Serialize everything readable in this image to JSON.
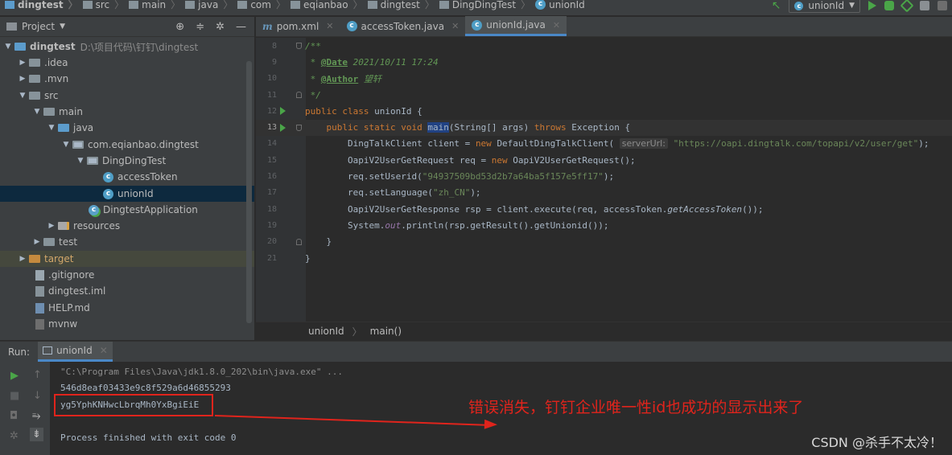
{
  "colors": {
    "accent": "#4a88c7",
    "run_green": "#4aa548",
    "annotation_red": "#e0241c",
    "keyword": "#cc7832",
    "string": "#6a8759",
    "comment": "#629755"
  },
  "breadcrumb": [
    "dingtest",
    "src",
    "main",
    "java",
    "com",
    "eqianbao",
    "dingtest",
    "DingDingTest",
    "unionId"
  ],
  "toolbar": {
    "run_config": "unionId",
    "run_icon": "play-icon",
    "debug_icon": "debug-icon",
    "build_icon": "hammer-icon"
  },
  "project": {
    "title": "Project",
    "tree": [
      {
        "label": "dingtest",
        "path": "D:\\项目代码\\钉钉\\dingtest",
        "icon": "module-folder-icon"
      },
      {
        "label": ".idea",
        "icon": "folder-icon"
      },
      {
        "label": ".mvn",
        "icon": "folder-icon"
      },
      {
        "label": "src",
        "icon": "folder-icon"
      },
      {
        "label": "main",
        "icon": "folder-icon"
      },
      {
        "label": "java",
        "icon": "source-folder-icon"
      },
      {
        "label": "com.eqianbao.dingtest",
        "icon": "package-icon"
      },
      {
        "label": "DingDingTest",
        "icon": "package-icon"
      },
      {
        "label": "accessToken",
        "icon": "class-icon"
      },
      {
        "label": "unionId",
        "icon": "class-icon"
      },
      {
        "label": "DingtestApplication",
        "icon": "spring-class-icon"
      },
      {
        "label": "resources",
        "icon": "resources-folder-icon"
      },
      {
        "label": "test",
        "icon": "folder-icon"
      },
      {
        "label": "target",
        "icon": "excluded-folder-icon"
      },
      {
        "label": ".gitignore",
        "icon": "gitignore-file-icon"
      },
      {
        "label": "dingtest.iml",
        "icon": "iml-file-icon"
      },
      {
        "label": "HELP.md",
        "icon": "markdown-file-icon"
      },
      {
        "label": "mvnw",
        "icon": "script-file-icon"
      }
    ]
  },
  "editor": {
    "tabs": [
      {
        "label": "pom.xml"
      },
      {
        "label": "accessToken.java"
      },
      {
        "label": "unionId.java"
      }
    ],
    "line_numbers": [
      "8",
      "9",
      "10",
      "11",
      "12",
      "13",
      "14",
      "15",
      "16",
      "17",
      "18",
      "19",
      "20",
      "21"
    ],
    "comment": {
      "open": "/**",
      "date_tag": "@Date",
      "date_val": "2021/10/11 17:24",
      "author_tag": "@Author",
      "author_val": "望轩",
      "close": "*/",
      "star": "*"
    },
    "code": {
      "kw_public": "public",
      "kw_class": "class",
      "class_name": "unionId",
      "brace_open": "{",
      "kw_static": "static",
      "kw_void": "void",
      "method": "main",
      "params": "(String[] args)",
      "kw_throws": "throws",
      "exception": "Exception",
      "l14a": "DingTalkClient client = ",
      "kw_new": "new",
      "l14b": "DefaultDingTalkClient(",
      "hint": "serverUrl:",
      "url": "\"https://oapi.dingtalk.com/topapi/v2/user/get\"",
      "l14c": ");",
      "l15a": "OapiV2UserGetRequest req = ",
      "l15b": "OapiV2UserGetRequest();",
      "l16a": "req.setUserid(",
      "userid": "\"94937509bd53d2b7a64ba5f157e5ff17\"",
      "l16b": ");",
      "l17a": "req.setLanguage(",
      "lang": "\"zh_CN\"",
      "l17b": ");",
      "l18a": "OapiV2UserGetResponse rsp = client.execute(req, accessToken.",
      "l18m": "getAccessToken",
      "l18b": "());",
      "l19a": "System.",
      "l19out": "out",
      "l19b": ".println(rsp.getResult().getUnionid());",
      "brace_close": "}"
    },
    "breadcrumb": {
      "cls": "unionId",
      "method": "main()"
    }
  },
  "run": {
    "label": "Run:",
    "tab": "unionId",
    "cmd": "\"C:\\Program Files\\Java\\jdk1.8.0_202\\bin\\java.exe\" ...",
    "out1": "546d8eaf03433e9c8f529a6d46855293",
    "out2": "yg5YphKNHwcLbrqMh0YxBgiEiE",
    "exit": "Process finished with exit code 0"
  },
  "annotation": "错误消失，钉钉企业唯一性id也成功的显示出来了",
  "watermark": "CSDN @杀手不太冷！"
}
